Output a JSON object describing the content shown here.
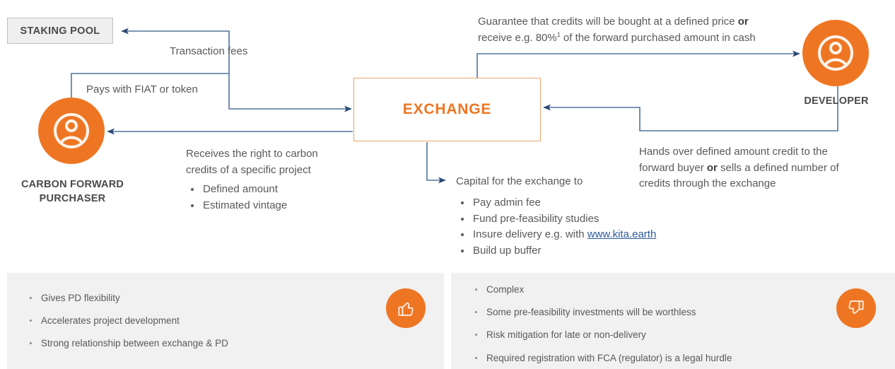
{
  "nodes": {
    "staking_pool": "STAKING POOL",
    "exchange": "EXCHANGE",
    "purchaser_caption_line1": "CARBON FORWARD",
    "purchaser_caption_line2": "PURCHASER",
    "developer_caption": "DEVELOPER"
  },
  "flows": {
    "transaction_fees": "Transaction fees",
    "pays_with": "Pays with FIAT or token",
    "guarantee_line1_a": "Guarantee that credits will be bought at a defined price ",
    "guarantee_line1_b": "or",
    "guarantee_line2_a": "receive e.g. 80%",
    "guarantee_line2_sup": "1",
    "guarantee_line2_b": " of the forward purchased amount in cash",
    "hands_over_a": "Hands over defined amount credit to the forward buyer ",
    "hands_over_b": "or",
    "hands_over_c": " sells a defined number of credits through the exchange",
    "receives_right": "Receives the right to carbon credits of a specific project",
    "receives_bullets": [
      "Defined amount",
      "Estimated vintage"
    ],
    "capital_heading": "Capital for the exchange to",
    "capital_bullets": [
      {
        "text": "Pay admin fee"
      },
      {
        "text": "Fund pre-feasibility studies"
      },
      {
        "text": "Insure delivery e.g. with ",
        "link": "www.kita.earth"
      },
      {
        "text": "Build up buffer"
      }
    ]
  },
  "panels": {
    "pros": {
      "icon": "thumbs-up-icon",
      "items": [
        "Gives PD flexibility",
        "Accelerates project development",
        "Strong relationship between exchange & PD"
      ]
    },
    "cons": {
      "icon": "thumbs-down-icon",
      "items": [
        "Complex",
        "Some pre-feasibility investments will be worthless",
        "Risk mitigation for late or non-delivery",
        "Required registration with FCA (regulator) is a legal hurdle"
      ]
    }
  },
  "colors": {
    "orange": "#EE7623",
    "arrow_blue": "#3F5F84",
    "panel_gray": "#F1F1F1",
    "box_gray": "#EFEFEF",
    "text_gray": "#58595B",
    "link_blue": "#2D5A9E"
  }
}
